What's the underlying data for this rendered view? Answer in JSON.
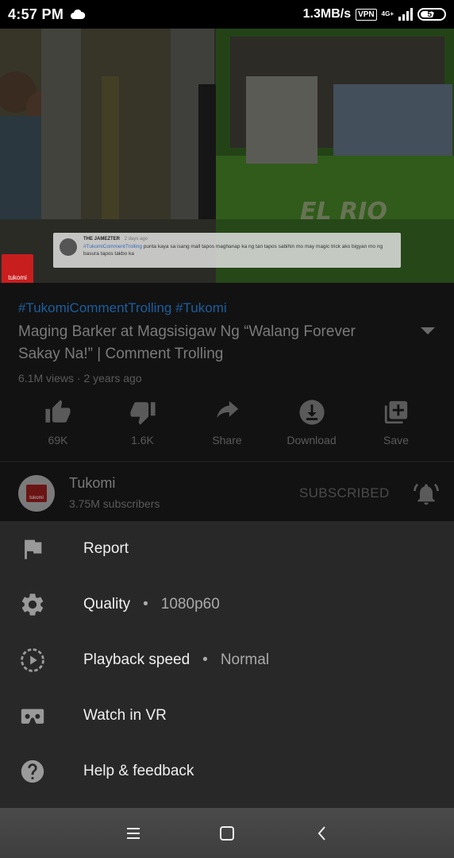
{
  "status_bar": {
    "time": "4:57 PM",
    "network_speed": "1.3MB/s",
    "vpn": "VPN",
    "network_type": "4G+",
    "battery": "57"
  },
  "video": {
    "overlay_comment": {
      "user": "THE JAMEZTER",
      "ago": "2 days ago",
      "hashtag": "#TukomiCommentTrolling",
      "text": " punta kaya sa isang mall tapos maghanap ka ng tan tapos sabihin mo may magic trick ako bigyan mo ng basura tapos takbo ka"
    },
    "logo_text": "tukomi"
  },
  "details": {
    "hashtags": "#TukomiCommentTrolling #Tukomi",
    "title": "Maging Barker at Magsisigaw Ng “Walang Forever Sakay Na!” | Comment Trolling",
    "meta": "6.1M views · 2 years ago",
    "actions": [
      {
        "icon": "thumbs-up-icon",
        "label": "69K"
      },
      {
        "icon": "thumbs-down-icon",
        "label": "1.6K"
      },
      {
        "icon": "share-icon",
        "label": "Share"
      },
      {
        "icon": "download-icon",
        "label": "Download"
      },
      {
        "icon": "add-to-playlist-icon",
        "label": "Save"
      }
    ]
  },
  "channel": {
    "name": "Tukomi",
    "subscribers": "3.75M subscribers",
    "subscribe_state": "SUBSCRIBED",
    "avatar_text": "tukomi"
  },
  "menu": {
    "items": [
      {
        "icon": "flag-icon",
        "label": "Report"
      },
      {
        "icon": "gear-icon",
        "label": "Quality",
        "value": "1080p60"
      },
      {
        "icon": "playback-speed-icon",
        "label": "Playback speed",
        "value": "Normal"
      },
      {
        "icon": "vr-headset-icon",
        "label": "Watch in VR"
      },
      {
        "icon": "help-icon",
        "label": "Help & feedback"
      }
    ]
  },
  "colors": {
    "sheet_bg": "#282828",
    "hashtag": "#1d5e9e",
    "brand_red": "#c81e1e"
  }
}
